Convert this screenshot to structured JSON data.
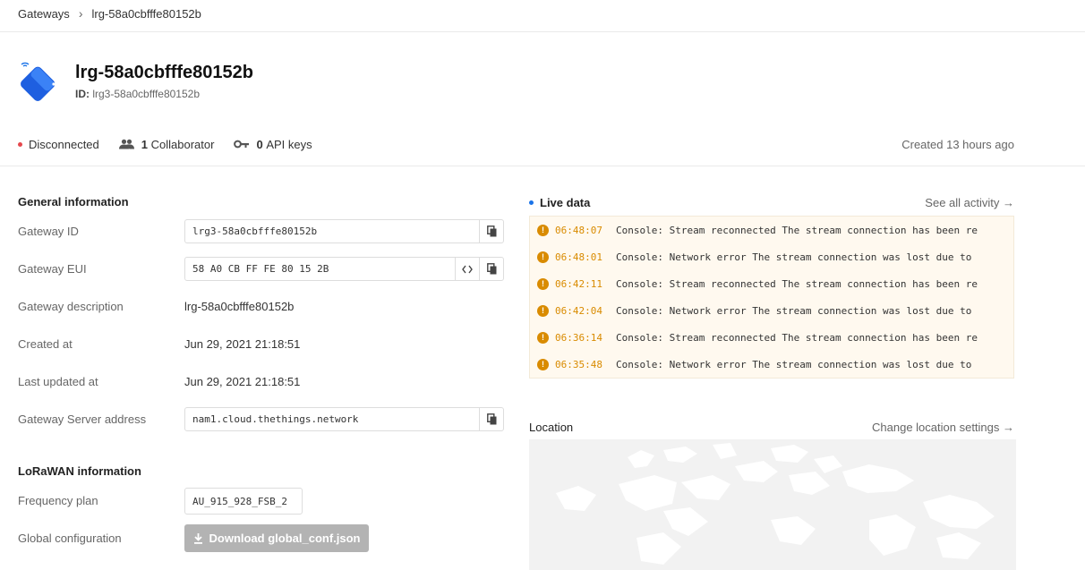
{
  "breadcrumb": {
    "root": "Gateways",
    "current": "lrg-58a0cbfffe80152b"
  },
  "gateway": {
    "title": "lrg-58a0cbfffe80152b",
    "id_label": "ID:",
    "id_value": "lrg3-58a0cbfffe80152b"
  },
  "status": {
    "connection": "Disconnected",
    "connection_color": "#e5484d",
    "collaborators_count": "1",
    "collaborators_label": "Collaborator",
    "api_keys_count": "0",
    "api_keys_label": "API keys",
    "created": "Created 13 hours ago"
  },
  "general": {
    "title": "General information",
    "gateway_id_label": "Gateway ID",
    "gateway_id_value": "lrg3-58a0cbfffe80152b",
    "gateway_eui_label": "Gateway EUI",
    "gateway_eui_value": "58 A0 CB FF FE 80 15 2B",
    "description_label": "Gateway description",
    "description_value": "lrg-58a0cbfffe80152b",
    "created_label": "Created at",
    "created_value": "Jun 29, 2021 21:18:51",
    "updated_label": "Last updated at",
    "updated_value": "Jun 29, 2021 21:18:51",
    "server_label": "Gateway Server address",
    "server_value": "nam1.cloud.thethings.network"
  },
  "lorawan": {
    "title": "LoRaWAN information",
    "freq_label": "Frequency plan",
    "freq_value": "AU_915_928_FSB_2",
    "global_conf_label": "Global configuration",
    "download_label": "Download global_conf.json"
  },
  "live": {
    "title": "Live data",
    "indicator_color": "#1a73e8",
    "see_all": "See all activity →",
    "events": [
      {
        "time": "06:48:07",
        "message": "Console: Stream reconnected  The stream connection has been re"
      },
      {
        "time": "06:48:01",
        "message": "Console: Network error  The stream connection was lost due to"
      },
      {
        "time": "06:42:11",
        "message": "Console: Stream reconnected  The stream connection has been re"
      },
      {
        "time": "06:42:04",
        "message": "Console: Network error  The stream connection was lost due to"
      },
      {
        "time": "06:36:14",
        "message": "Console: Stream reconnected  The stream connection has been re"
      },
      {
        "time": "06:35:48",
        "message": "Console: Network error  The stream connection was lost due to"
      }
    ]
  },
  "location": {
    "title": "Location",
    "link": "Change location settings →"
  }
}
